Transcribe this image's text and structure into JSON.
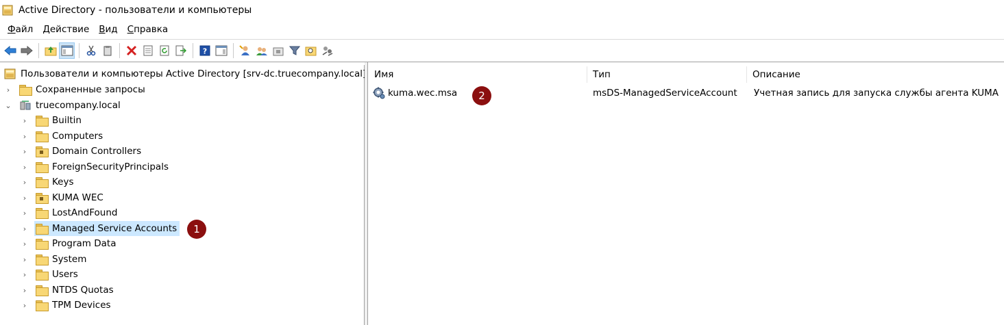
{
  "window": {
    "title": "Active Directory - пользователи и компьютеры",
    "icon": "ad-console-icon"
  },
  "menu": [
    {
      "accel": "Ф",
      "rest": "айл"
    },
    {
      "accel": "Д",
      "rest": "ействие"
    },
    {
      "accel": "В",
      "rest": "ид"
    },
    {
      "accel": "С",
      "rest": "правка"
    }
  ],
  "toolbar": {
    "icons": [
      "back-arrow-icon",
      "forward-arrow-icon",
      "up-folder-icon",
      "show-console-tree-icon",
      "cut-icon",
      "paste-icon",
      "delete-icon",
      "properties-icon",
      "refresh-icon",
      "export-list-icon",
      "help-icon",
      "action-pane-icon",
      "new-user-icon",
      "new-group-icon",
      "new-ou-icon",
      "filter-icon",
      "find-icon",
      "delegate-control-icon"
    ]
  },
  "tree": {
    "root": "Пользователи и компьютеры Active Directory [srv-dc.truecompany.local]",
    "saved_queries": "Сохраненные запросы",
    "domain": "truecompany.local",
    "children": [
      "Builtin",
      "Computers",
      "Domain Controllers",
      "ForeignSecurityPrincipals",
      "Keys",
      "KUMA WEC",
      "LostAndFound",
      "Managed Service Accounts",
      "Program Data",
      "System",
      "Users",
      "NTDS Quotas",
      "TPM Devices"
    ],
    "selected_index": 7
  },
  "list": {
    "columns": [
      "Имя",
      "Тип",
      "Описание"
    ],
    "rows": [
      {
        "name": "kuma.wec.msa",
        "type": "msDS-ManagedServiceAccount",
        "description": "Учетная запись для запуска службы агента KUMA"
      }
    ]
  },
  "annotations": {
    "badge1": "1",
    "badge2": "2"
  },
  "colors": {
    "badge": "#8b0f0f",
    "selection": "#cce8ff",
    "folder": "#f8d775"
  }
}
